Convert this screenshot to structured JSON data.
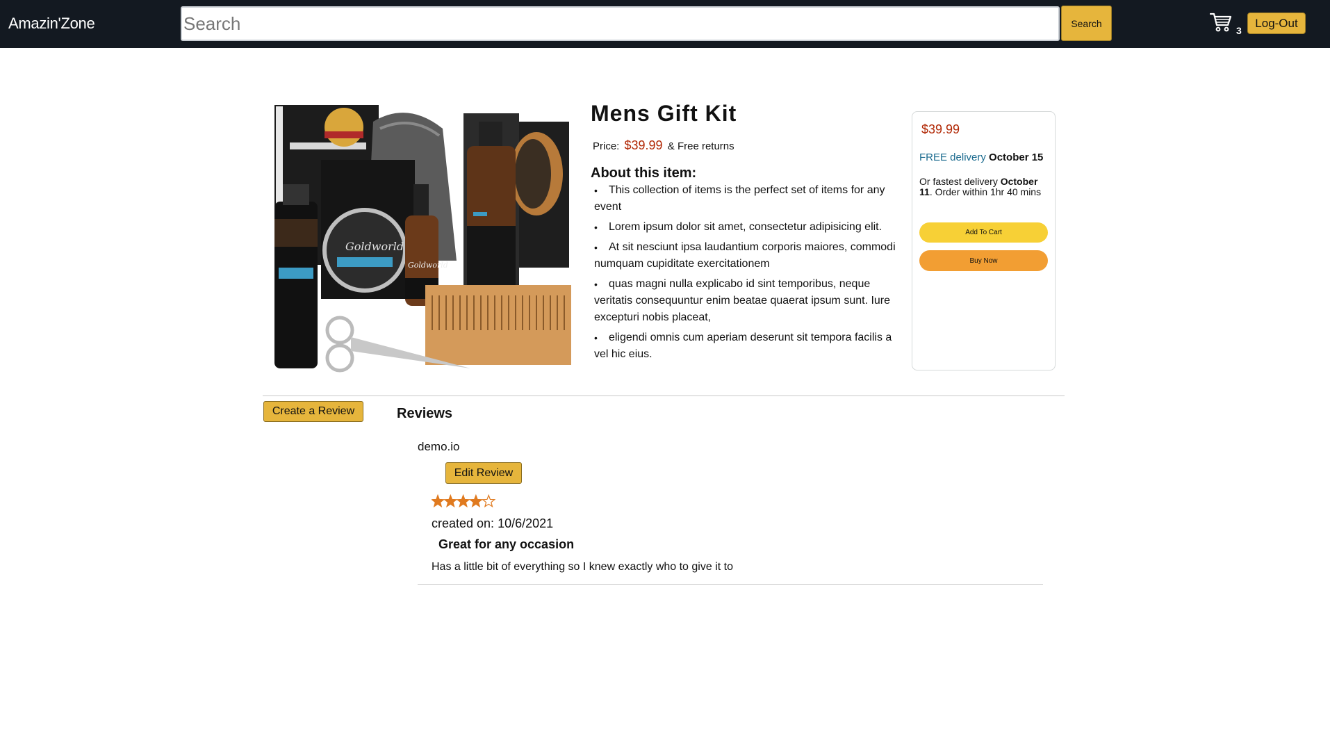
{
  "header": {
    "logo": "Amazin'Zone",
    "search_placeholder": "Search",
    "search_button": "Search",
    "cart_count": "3",
    "logout_button": "Log-Out"
  },
  "product": {
    "title": "Mens Gift Kit",
    "price_label": "Price:",
    "price": "$39.99",
    "ampersand": "&",
    "returns": "Free returns",
    "about_heading": "About this item:",
    "bullets": [
      "This collection of items is the perfect set of items for any event",
      "Lorem ipsum dolor sit amet, consectetur adipisicing elit.",
      "At sit nesciunt ipsa laudantium corporis maiores, commodi numquam cupiditate exercitationem",
      "quas magni nulla explicabo id sint temporibus, neque veritatis consequuntur enim beatae quaerat ipsum sunt. Iure excepturi nobis placeat,",
      "eligendi omnis cum aperiam deserunt sit tempora facilis a vel hic eius."
    ],
    "image_icon": "product-image"
  },
  "buybox": {
    "price": "$39.99",
    "free_delivery": "FREE delivery",
    "free_date": "October 15",
    "fastest_prefix": "Or fastest delivery",
    "fastest_date": "October 11",
    "fastest_suffix": ". Order within 1hr 40 mins",
    "add_to_cart": "Add To Cart",
    "buy_now": "Buy Now"
  },
  "reviews": {
    "create_button": "Create a Review",
    "heading": "Reviews",
    "items": [
      {
        "user": "demo.io",
        "edit_button": "Edit Review",
        "rating": 4,
        "max_rating": 5,
        "created": "created on: 10/6/2021",
        "title": "Great for any occasion",
        "body": "Has a little bit of everything so I knew exactly who to give it to"
      }
    ]
  },
  "colors": {
    "header_bg": "#131921",
    "accent": "#e6b53c",
    "price": "#b12704",
    "star": "#e07a1f",
    "link": "#1a6a8e"
  }
}
